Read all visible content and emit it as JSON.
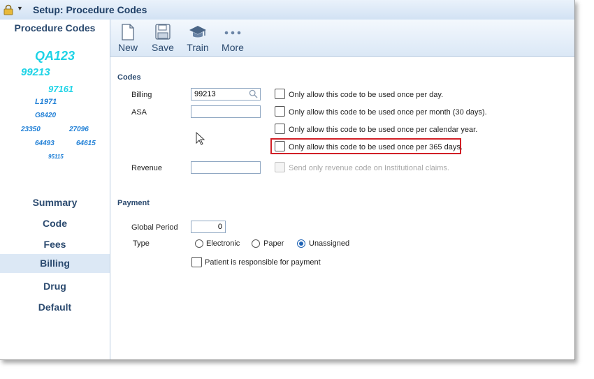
{
  "window": {
    "title": "Setup: Procedure Codes"
  },
  "sidebar": {
    "header": "Procedure Codes",
    "codes": [
      "QA123",
      "99213",
      "97161",
      "L1971",
      "G8420",
      "23350",
      "27096",
      "64493",
      "64615",
      "95115"
    ],
    "nav": [
      {
        "label": "Summary",
        "active": false
      },
      {
        "label": "Code",
        "active": false
      },
      {
        "label": "Fees",
        "active": false
      },
      {
        "label": "Billing",
        "active": true
      },
      {
        "label": "Drug",
        "active": false
      },
      {
        "label": "Default",
        "active": false
      }
    ]
  },
  "toolbar": {
    "new_label": "New",
    "save_label": "Save",
    "train_label": "Train",
    "more_label": "More"
  },
  "codes_section": {
    "title": "Codes",
    "billing_label": "Billing",
    "billing_value": "99213",
    "asa_label": "ASA",
    "asa_value": "",
    "revenue_label": "Revenue",
    "revenue_value": "",
    "options": [
      "Only allow this code to be used once per day.",
      "Only allow this code to be used once per month (30 days).",
      "Only allow this code to be used once per calendar year.",
      "Only allow this code to be used once per 365 days."
    ],
    "revenue_option": "Send only revenue code on Institutional claims."
  },
  "payment_section": {
    "title": "Payment",
    "global_period_label": "Global Period",
    "global_period_value": "0",
    "type_label": "Type",
    "types": [
      "Electronic",
      "Paper",
      "Unassigned"
    ],
    "selected_type": "Unassigned",
    "patient_responsible_label": "Patient is responsible for payment"
  },
  "colors": {
    "accent": "#2b4a6f",
    "code_cyan": "#1ed3e6",
    "code_blue": "#1f7fd6",
    "highlight": "#d11f26"
  }
}
